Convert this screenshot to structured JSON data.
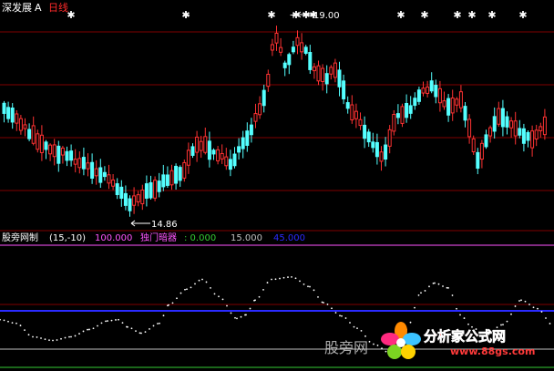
{
  "header": {
    "stock_name": "深发展",
    "badge": "A",
    "period": "日线"
  },
  "chart_data": {
    "type": "candlestick",
    "price_panel": {
      "high_label": "19.00",
      "low_label": "14.86",
      "candles_count": 130,
      "star_markers": 14
    },
    "indicator_panel": {
      "name": "股旁网制",
      "params": "(15,-10)",
      "values": [
        {
          "text": "100.000",
          "color": "#ff55ff"
        },
        {
          "text": "独门暗器",
          "color": "#ff55ff"
        },
        {
          "text": ": 0.000",
          "color": "#33cc33"
        },
        {
          "text": "15.000",
          "color": "#c0c0c0"
        },
        {
          "text": "45.000",
          "color": "#2a2aff"
        }
      ],
      "levels": [
        {
          "value": 100,
          "color": "#ff55ff"
        },
        {
          "value": 45,
          "color": "#2a2aff"
        },
        {
          "value": 15,
          "color": "#c0c0c0"
        },
        {
          "value": 0,
          "color": "#33cc33"
        }
      ],
      "curve": [
        [
          0,
          39
        ],
        [
          18,
          36
        ],
        [
          36,
          25
        ],
        [
          58,
          22
        ],
        [
          78,
          25
        ],
        [
          98,
          31
        ],
        [
          118,
          38
        ],
        [
          130,
          39
        ],
        [
          140,
          33
        ],
        [
          155,
          28
        ],
        [
          175,
          36
        ],
        [
          185,
          51
        ],
        [
          205,
          64
        ],
        [
          222,
          72
        ],
        [
          240,
          58
        ],
        [
          260,
          40
        ],
        [
          270,
          43
        ],
        [
          280,
          55
        ],
        [
          298,
          72
        ],
        [
          320,
          74
        ],
        [
          340,
          66
        ],
        [
          355,
          53
        ],
        [
          375,
          42
        ],
        [
          392,
          32
        ],
        [
          410,
          19
        ],
        [
          430,
          11
        ],
        [
          446,
          31
        ],
        [
          462,
          61
        ],
        [
          477,
          69
        ],
        [
          492,
          65
        ],
        [
          505,
          43
        ],
        [
          518,
          33
        ],
        [
          532,
          26
        ],
        [
          552,
          35
        ],
        [
          572,
          55
        ],
        [
          590,
          48
        ],
        [
          606,
          35
        ]
      ],
      "ylim": [
        0,
        100
      ]
    }
  },
  "watermark": {
    "text": "股旁网",
    "logo": "分析家公式网",
    "url": "www.88gs.com"
  },
  "colors": {
    "bg": "#000000",
    "up": "#ff3232",
    "down": "#54ffff",
    "grid": "#800000",
    "text_white": "#ffffff",
    "text_red": "#ff2a2a"
  }
}
